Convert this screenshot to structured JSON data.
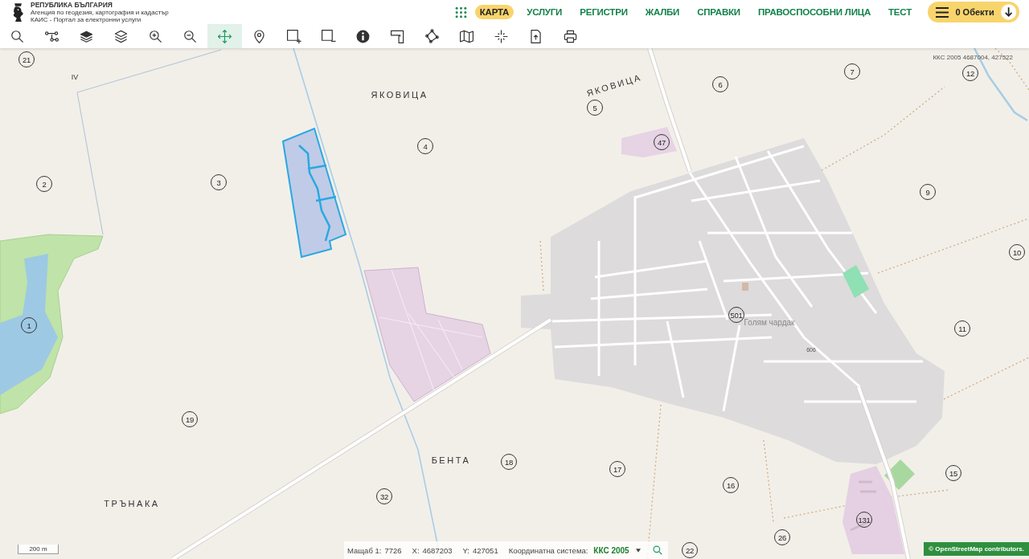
{
  "header": {
    "logo_lines": [
      "РЕПУБЛИКА БЪЛГАРИЯ",
      "Агенция по геодезия, картография и кадастър",
      "КАИС - Портал за електронни услуги"
    ],
    "nav": [
      {
        "label": "КАРТА",
        "selected": true
      },
      {
        "label": "УСЛУГИ",
        "selected": false
      },
      {
        "label": "РЕГИСТРИ",
        "selected": false
      },
      {
        "label": "ЖАЛБИ",
        "selected": false
      },
      {
        "label": "СПРАВКИ",
        "selected": false
      },
      {
        "label": "ПРАВОСПОСОБНИ ЛИЦА",
        "selected": false
      },
      {
        "label": "ТЕСТ",
        "selected": false
      }
    ],
    "objects_button": {
      "label": "0 Обекти"
    }
  },
  "toolbar": {
    "tools": [
      {
        "selected": false
      },
      {
        "selected": false
      },
      {
        "selected": false
      },
      {
        "selected": false
      },
      {
        "selected": false
      },
      {
        "selected": false
      },
      {
        "selected": true
      },
      {
        "selected": false
      },
      {
        "selected": false
      },
      {
        "selected": false
      },
      {
        "selected": false
      },
      {
        "selected": false
      },
      {
        "selected": false
      },
      {
        "selected": false
      },
      {
        "selected": false
      },
      {
        "selected": false
      },
      {
        "selected": false
      }
    ]
  },
  "map": {
    "coordinates_readout": "ККС 2005 4687004, 427522",
    "place_labels": [
      {
        "text": "IV",
        "kind": "sector"
      },
      {
        "text": "ЯКОВИЦА",
        "kind": "area"
      },
      {
        "text": "ЯКОВИЦА",
        "kind": "area"
      },
      {
        "text": "Голям чардак",
        "kind": "village"
      },
      {
        "text": "606",
        "kind": "road"
      },
      {
        "text": "БЕНТА",
        "kind": "area"
      },
      {
        "text": "ТРЪНАКА",
        "kind": "area"
      }
    ],
    "parcel_numbers": [
      "21",
      "12",
      "7",
      "6",
      "5",
      "47",
      "4",
      "3",
      "2",
      "9",
      "10",
      "501",
      "1",
      "11",
      "19",
      "18",
      "17",
      "15",
      "16",
      "32",
      "131",
      "26",
      "22"
    ],
    "scale_bar": "200 m",
    "attribution": "© OpenStreetMap contributors."
  },
  "status_bar": {
    "scale_label": "Мащаб 1:",
    "scale_value": "7726",
    "x_label": "X:",
    "x_value": "4687203",
    "y_label": "Y:",
    "y_value": "427051",
    "crs_label": "Координатна система:",
    "crs_value": "ККС 2005"
  }
}
